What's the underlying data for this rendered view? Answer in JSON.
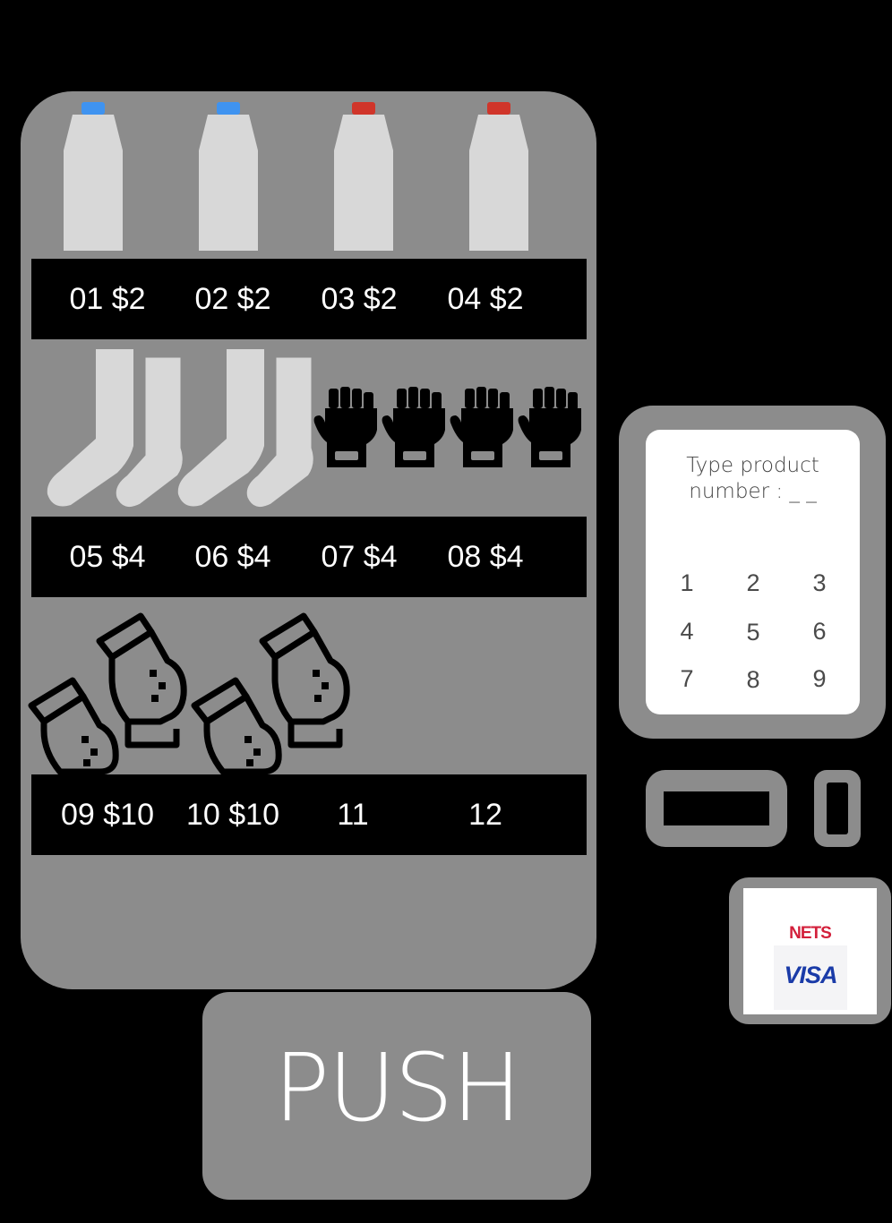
{
  "machine": {
    "rows": [
      {
        "labels": [
          "01 $2",
          "02 $2",
          "03 $2",
          "04 $2"
        ]
      },
      {
        "labels": [
          "05 $4",
          "06 $4",
          "07 $4",
          "08 $4"
        ]
      },
      {
        "labels": [
          "09 $10",
          "10 $10",
          "11",
          "12"
        ]
      }
    ],
    "bottle_cap_colors": [
      "#3f93f0",
      "#3f93f0",
      "#d0352a",
      "#d0352a"
    ]
  },
  "keypad": {
    "prompt_line1": "Type product",
    "prompt_line2": "number : _ _",
    "keys": [
      "1",
      "2",
      "3",
      "4",
      "5",
      "6",
      "7",
      "8",
      "9"
    ]
  },
  "card_reader": {
    "brand1": "NETS",
    "brand2": "VISA"
  },
  "push_door": {
    "label": "PUSH"
  },
  "colors": {
    "cabinet": "#8c8c8c",
    "product": "#d8d8d8",
    "background": "#000000"
  }
}
